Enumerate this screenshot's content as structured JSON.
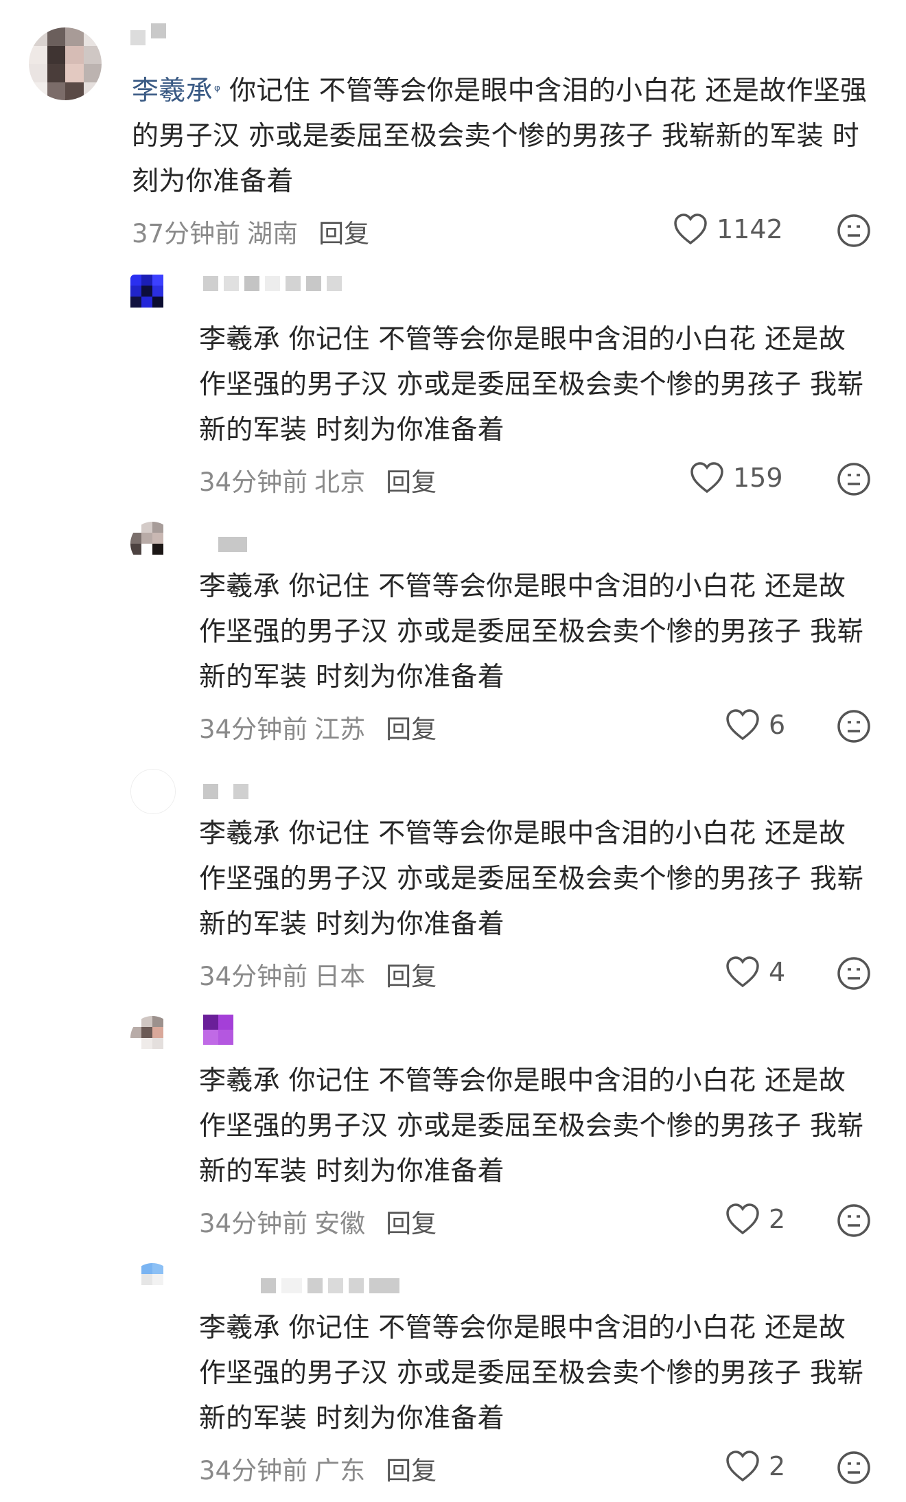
{
  "comments": [
    {
      "mention": "李羲承",
      "mention_suffix": "ᵠ",
      "text": "你记住 不管等会你是眼中含泪的小白花 还是故作坚强的男子汉 亦或是委屈至极会卖个惨的男孩子 我崭新的军装 时刻为你准备着",
      "time": "37分钟前",
      "location": "湖南",
      "reply": "回复",
      "likes": "1142"
    },
    {
      "mention": "",
      "text": "李羲承 你记住 不管等会你是眼中含泪的小白花 还是故作坚强的男子汉 亦或是委屈至极会卖个惨的男孩子 我崭新的军装 时刻为你准备着",
      "time": "34分钟前",
      "location": "北京",
      "reply": "回复",
      "likes": "159"
    },
    {
      "mention": "",
      "text": "李羲承  你记住 不管等会你是眼中含泪的小白花 还是故作坚强的男子汉 亦或是委屈至极会卖个惨的男孩子 我崭新的军装 时刻为你准备着",
      "time": "34分钟前",
      "location": "江苏",
      "reply": "回复",
      "likes": "6"
    },
    {
      "mention": "",
      "text": "李羲承 你记住 不管等会你是眼中含泪的小白花 还是故作坚强的男子汉 亦或是委屈至极会卖个惨的男孩子 我崭新的军装 时刻为你准备着",
      "time": "34分钟前",
      "location": "日本",
      "reply": "回复",
      "likes": "4"
    },
    {
      "mention": "",
      "text": "李羲承 你记住 不管等会你是眼中含泪的小白花 还是故作坚强的男子汉 亦或是委屈至极会卖个惨的男孩子 我崭新的军装 时刻为你准备着",
      "time": "34分钟前",
      "location": "安徽",
      "reply": "回复",
      "likes": "2"
    },
    {
      "mention": "",
      "text": "李羲承  你记住 不管等会你是眼中含泪的小白花 还是故作坚强的男子汉 亦或是委屈至极会卖个惨的男孩子 我崭新的军装 时刻为你准备着",
      "time": "34分钟前",
      "location": "广东",
      "reply": "回复",
      "likes": "2"
    }
  ],
  "icons": {
    "like": "heart-outline-icon",
    "reaction": "neutral-face-icon"
  },
  "colors": {
    "mention": "#3a5a84",
    "meta": "#8a8a8a",
    "text": "#262626"
  }
}
